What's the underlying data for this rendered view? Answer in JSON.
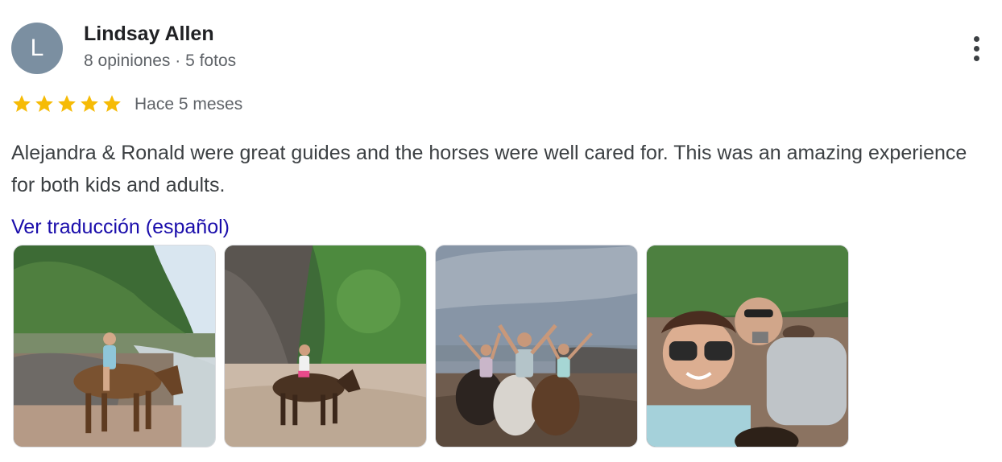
{
  "review": {
    "avatar_letter": "L",
    "author": "Lindsay Allen",
    "meta": "8 opiniones · 5 fotos",
    "rating": 5,
    "age": "Hace 5 meses",
    "text": "Alejandra & Ronald were great guides and the horses were well cared for. This was an amazing experience for both kids and adults.",
    "translate_link": "Ver traducción (español)",
    "more_icon": "more-vert-icon",
    "star_icon": "star-icon",
    "star_color": "#f6bb06",
    "avatar_color": "#7b8fa1",
    "link_color": "#1a0dab",
    "photos": [
      {
        "name": "photo-girl-on-horse-riverside"
      },
      {
        "name": "photo-girl-on-horse-beach-cliff"
      },
      {
        "name": "photo-family-on-horses-arms-raised"
      },
      {
        "name": "photo-couple-selfie-beach"
      }
    ]
  }
}
